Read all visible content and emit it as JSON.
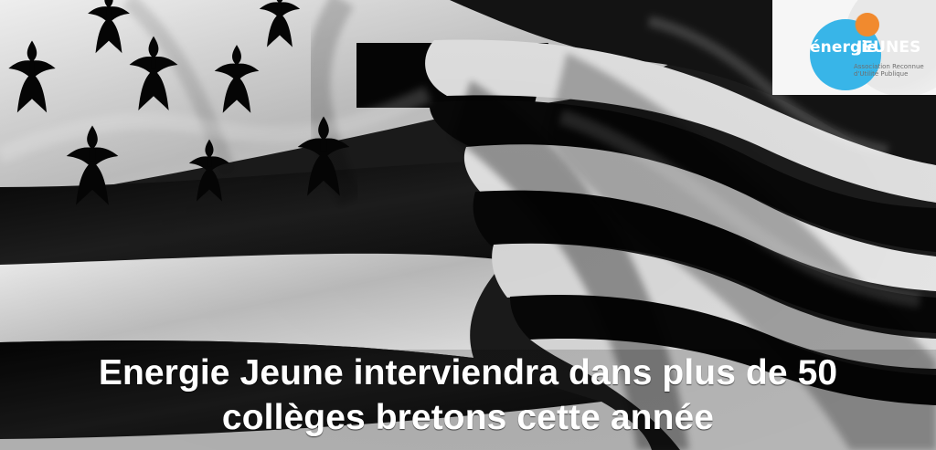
{
  "hero": {
    "headline": "Energie Jeune interviendra dans plus de 50 collèges bretons cette année"
  },
  "logo": {
    "word_1": "énergie",
    "word_2": "JEUNES",
    "tagline": "Association Reconnue d'Utilité Publique"
  },
  "colors": {
    "logo_blue": "#38b5e8",
    "logo_orange": "#f28a2e",
    "flag_black": "#111111",
    "flag_white": "#d4d4d4"
  },
  "icons": {
    "logo_mark": "energie-jeunes-circles"
  }
}
